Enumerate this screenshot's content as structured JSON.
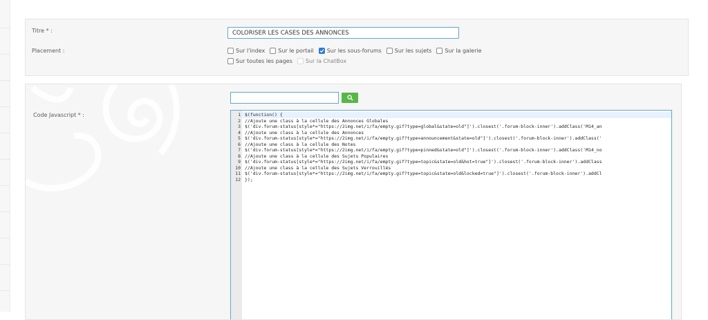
{
  "form": {
    "title_label": "Titre * :",
    "title_value": "COLORISER LES CASES DES ANNONCES",
    "placement_label": "Placement :",
    "placement_options": [
      {
        "label": "Sur l'index",
        "checked": false
      },
      {
        "label": "Sur le portail",
        "checked": false
      },
      {
        "label": "Sur les sous-forums",
        "checked": true
      },
      {
        "label": "Sur les sujets",
        "checked": false
      },
      {
        "label": "Sur la galerie",
        "checked": false
      },
      {
        "label": "Sur toutes les pages",
        "checked": false
      },
      {
        "label": "Sur la ChatBox",
        "checked": false,
        "disabled": true
      }
    ],
    "code_label": "Code Javascript * :",
    "search_value": "",
    "search_icon": "search-icon"
  },
  "colors": {
    "accent_border": "#5ea6d3",
    "search_button": "#59b749",
    "checked": "#2b7cd3"
  },
  "editor": {
    "line_numbers": [
      "1",
      "2",
      "3",
      "4",
      "5",
      "6",
      "7",
      "8",
      "9",
      "10",
      "11",
      "12"
    ],
    "lines": [
      "$(function() {",
      "//Ajoute une class à la cellule des Annonces Globales",
      "$('div.forum-status[style*=\"https://2img.net/i/fa/empty.gif?type=global&state=old\"]').closest('.forum-block-inner').addClass('M14_an",
      "//Ajoute une class à la cellule des Annonces",
      "$('div.forum-status[style*=\"https://2img.net/i/fa/empty.gif?type=announcement&state=old\"]').closest('.forum-block-inner').addClass('",
      "//Ajoute une class à la cellule des Notes",
      "$('div.forum-status[style*=\"https://2img.net/i/fa/empty.gif?type=pinned&state=old\"]').closest('.forum-block-inner').addClass('M14_no",
      "//Ajoute une class à la cellule des Sujets Populaires",
      "$('div.forum-status[style*=\"https://2img.net/i/fa/empty.gif?type=topic&state=old&hot=true\"]').closest('.forum-block-inner').addClass",
      "//Ajoute une class à la cellule des Sujets Verrouillés",
      "$('div.forum-status[style*=\"https://2img.net/i/fa/empty.gif?type=topic&state=old&locked=true\"]').closest('.forum-block-inner').addCl",
      "});"
    ]
  }
}
